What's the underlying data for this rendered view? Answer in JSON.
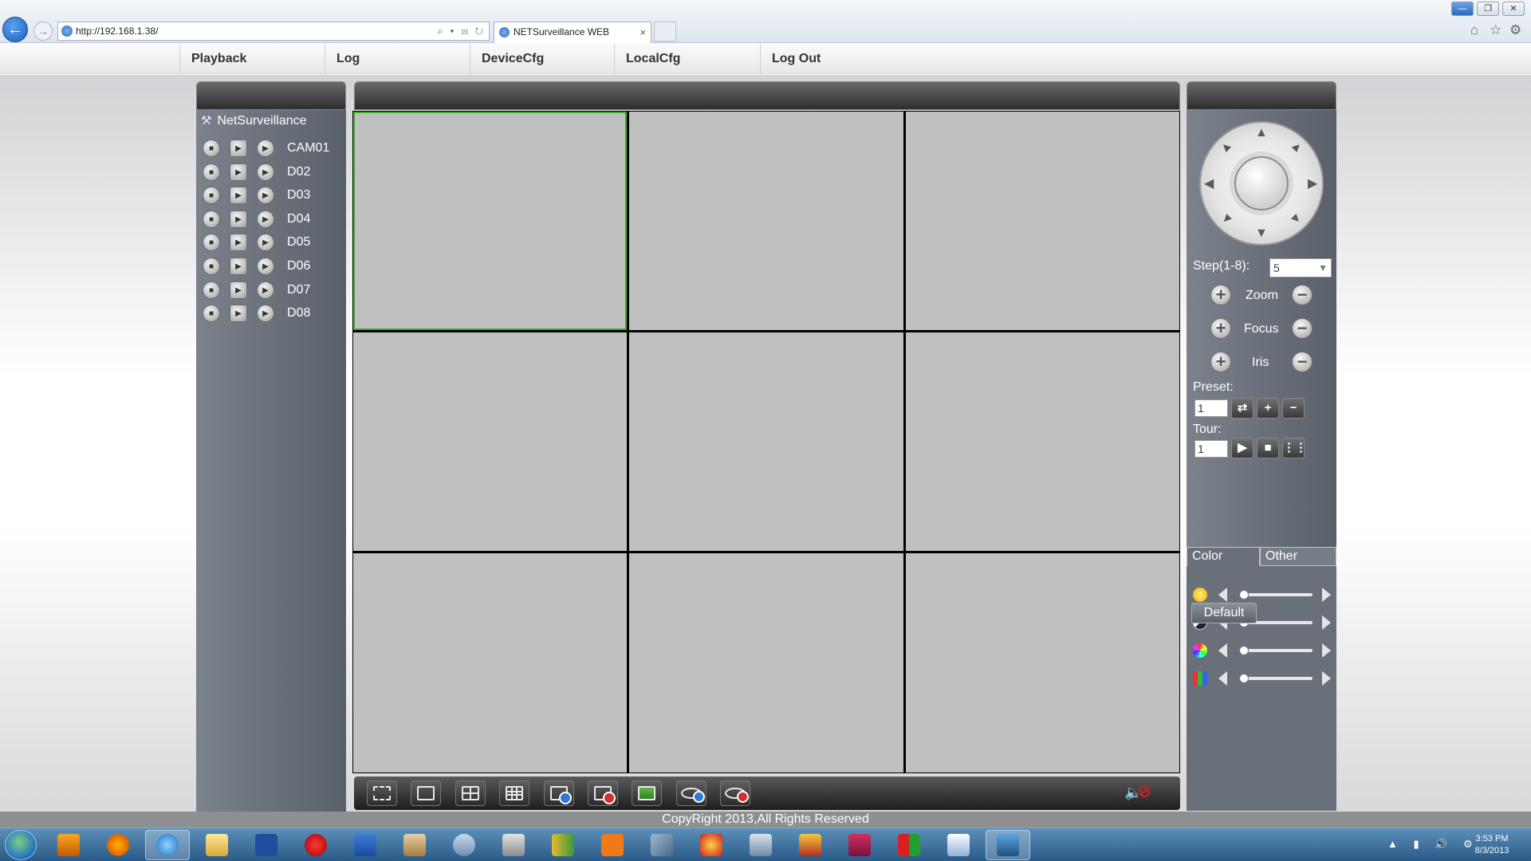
{
  "browser": {
    "url": "http://192.168.1.38/",
    "tab_title": "NETSurveillance WEB",
    "tab_close": "×",
    "address_tools": "⌕ ▾ ⊡ ↻"
  },
  "menu": [
    {
      "label": "Playback"
    },
    {
      "label": "Log"
    },
    {
      "label": "DeviceCfg"
    },
    {
      "label": "LocalCfg"
    },
    {
      "label": "Log Out"
    }
  ],
  "left_panel": {
    "root_label": "NetSurveillance",
    "cameras": [
      {
        "label": "CAM01"
      },
      {
        "label": "D02"
      },
      {
        "label": "D03"
      },
      {
        "label": "D04"
      },
      {
        "label": "D05"
      },
      {
        "label": "D06"
      },
      {
        "label": "D07"
      },
      {
        "label": "D08"
      }
    ]
  },
  "video": {
    "layout": "3x3",
    "active_cell": 1
  },
  "ptz": {
    "step_label": "Step(1-8):",
    "step_value": "5",
    "zoom_label": "Zoom",
    "focus_label": "Focus",
    "iris_label": "Iris",
    "preset_label": "Preset:",
    "preset_value": "1",
    "tour_label": "Tour:",
    "tour_value": "1"
  },
  "image_tabs": {
    "color_tab": "Color",
    "other_tab": "Other"
  },
  "color_sliders": [
    {
      "icon": "brightness-icon",
      "value": 0.0
    },
    {
      "icon": "contrast-icon",
      "value": 0.0
    },
    {
      "icon": "saturation-icon",
      "value": 0.0
    },
    {
      "icon": "hue-icon",
      "value": 0.0
    }
  ],
  "default_label": "Default",
  "footer": "CopyRight 2013,All Rights Reserved",
  "taskbar": {
    "time": "3:53 PM",
    "date": "8/3/2013"
  },
  "colors": {
    "active_cell_border": "#3fae2a",
    "video_cell_bg": "#c0c0c0",
    "panel_bg": "#6a7079"
  }
}
